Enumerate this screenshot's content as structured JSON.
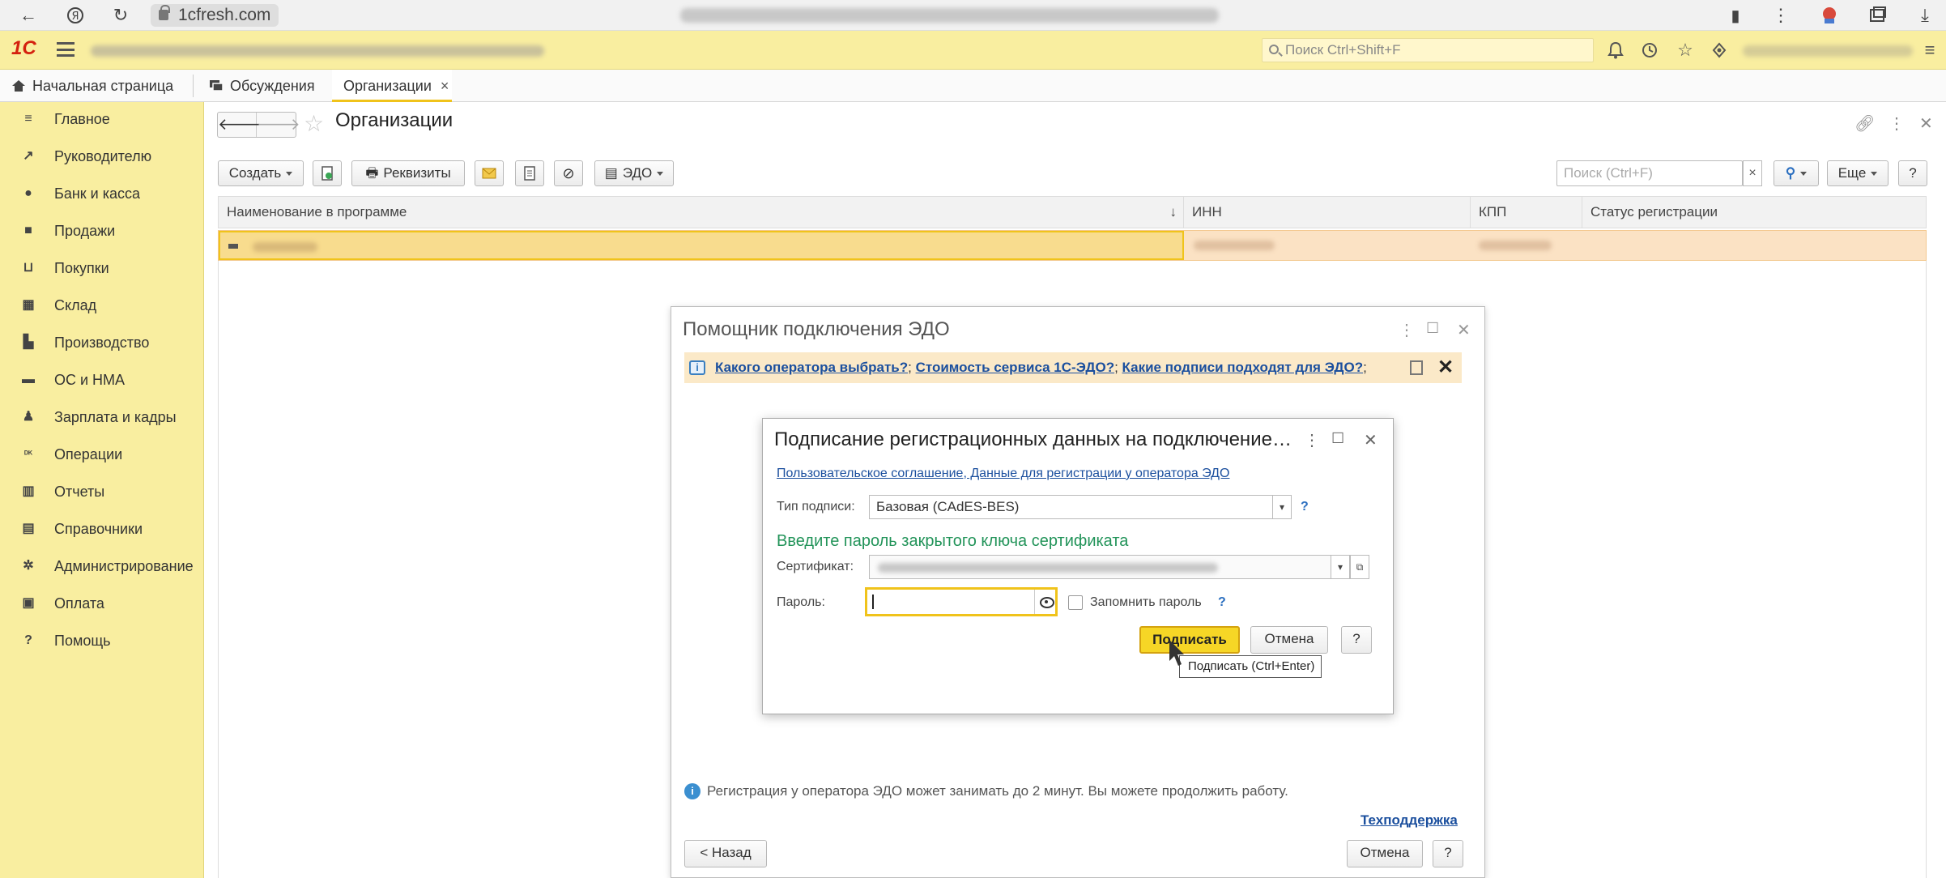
{
  "browser": {
    "url": "1cfresh.com"
  },
  "app": {
    "search_placeholder": "Поиск Ctrl+Shift+F"
  },
  "tabs": [
    {
      "label": "Начальная страница"
    },
    {
      "label": "Обсуждения"
    },
    {
      "label": "Организации",
      "close": "×"
    }
  ],
  "sidebar": {
    "items": [
      {
        "label": "Главное",
        "icon": "menu-icon"
      },
      {
        "label": "Руководителю",
        "icon": "trend-icon"
      },
      {
        "label": "Банк и касса",
        "icon": "coin-icon"
      },
      {
        "label": "Продажи",
        "icon": "bag-icon"
      },
      {
        "label": "Покупки",
        "icon": "cart-icon"
      },
      {
        "label": "Склад",
        "icon": "warehouse-icon"
      },
      {
        "label": "Производство",
        "icon": "factory-icon"
      },
      {
        "label": "ОС и НМА",
        "icon": "truck-icon"
      },
      {
        "label": "Зарплата и кадры",
        "icon": "person-icon"
      },
      {
        "label": "Операции",
        "icon": "operations-icon"
      },
      {
        "label": "Отчеты",
        "icon": "bar-chart-icon"
      },
      {
        "label": "Справочники",
        "icon": "book-icon"
      },
      {
        "label": "Администрирование",
        "icon": "gear-icon"
      },
      {
        "label": "Оплата",
        "icon": "wallet-icon"
      },
      {
        "label": "Помощь",
        "icon": "help-icon"
      }
    ]
  },
  "form": {
    "title": "Организации",
    "toolbar": {
      "create": "Создать",
      "requisites": "Реквизиты",
      "edo": "ЭДО",
      "more": "Еще",
      "help": "?"
    },
    "search_placeholder": "Поиск (Ctrl+F)",
    "search_clear": "×",
    "columns": [
      "Наименование в программе",
      "ИНН",
      "КПП",
      "Статус регистрации"
    ],
    "sort_indicator": "↓"
  },
  "wizard": {
    "title": "Помощник подключения ЭДО",
    "info_links": [
      "Какого оператора выбрать?",
      "Стоимость сервиса 1С-ЭДО?",
      "Какие подписи подходят для ЭДО?"
    ],
    "info_close": "✕",
    "note": "Регистрация у оператора ЭДО может занимать до 2 минут. Вы можете продолжить работу.",
    "support": "Техподдержка",
    "back": "< Назад",
    "cancel": "Отмена",
    "help": "?"
  },
  "dialog": {
    "title": "Подписание регистрационных данных на подключение…",
    "link": "Пользовательское соглашение, Данные для регистрации у оператора ЭДО",
    "signature_type_label": "Тип подписи:",
    "signature_type_value": "Базовая (CAdES-BES)",
    "section_heading": "Введите пароль закрытого ключа сертификата",
    "certificate_label": "Сертификат:",
    "password_label": "Пароль:",
    "remember_label": "Запомнить пароль",
    "remember_checked": false,
    "q": "?",
    "sign": "Подписать",
    "cancel": "Отмена",
    "help": "?",
    "tooltip": "Подписать (Ctrl+Enter)"
  }
}
